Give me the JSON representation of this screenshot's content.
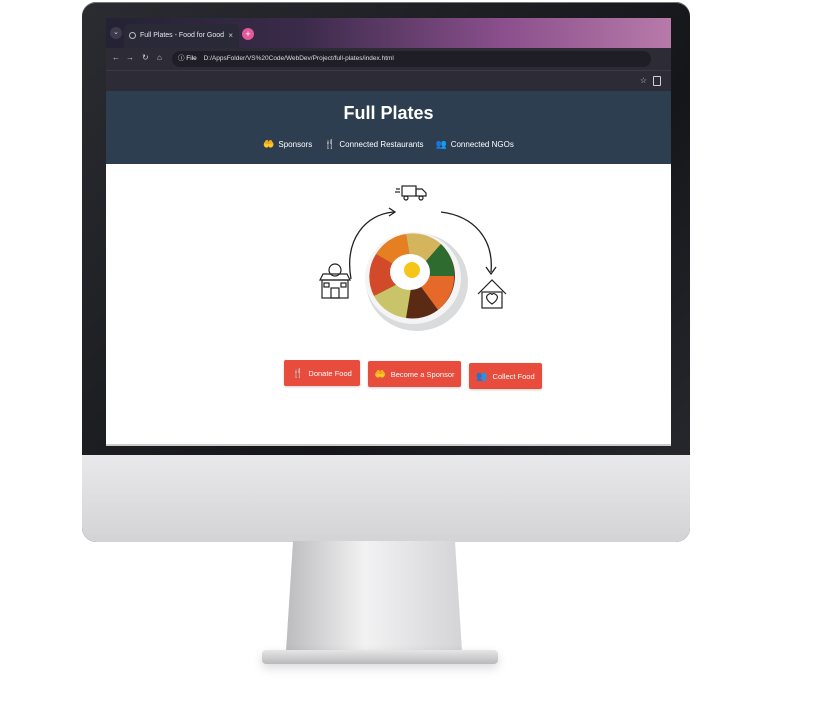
{
  "browser": {
    "tab_title": "Full Plates - Food for Good",
    "tab_close": "×",
    "new_tab": "+",
    "menu": "⌄",
    "address_chip": "ⓘ File",
    "url": "D:/AppsFolder/VS%20Code/WebDev/Project/full-plates/index.html",
    "back": "←",
    "forward": "→",
    "reload": "↻",
    "home": "⌂",
    "star": "☆"
  },
  "site": {
    "title": "Full Plates",
    "nav": [
      {
        "icon": "🤲",
        "label": "Sponsors"
      },
      {
        "icon": "🍴",
        "label": "Connected Restaurants"
      },
      {
        "icon": "👥",
        "label": "Connected NGOs"
      }
    ],
    "buttons": [
      {
        "icon": "🍴",
        "label": "Donate Food"
      },
      {
        "icon": "🤲",
        "label": "Become a Sponsor"
      },
      {
        "icon": "👥",
        "label": "Collect Food"
      }
    ]
  },
  "colors": {
    "header": "#2d3e50",
    "button": "#e74c3c"
  }
}
